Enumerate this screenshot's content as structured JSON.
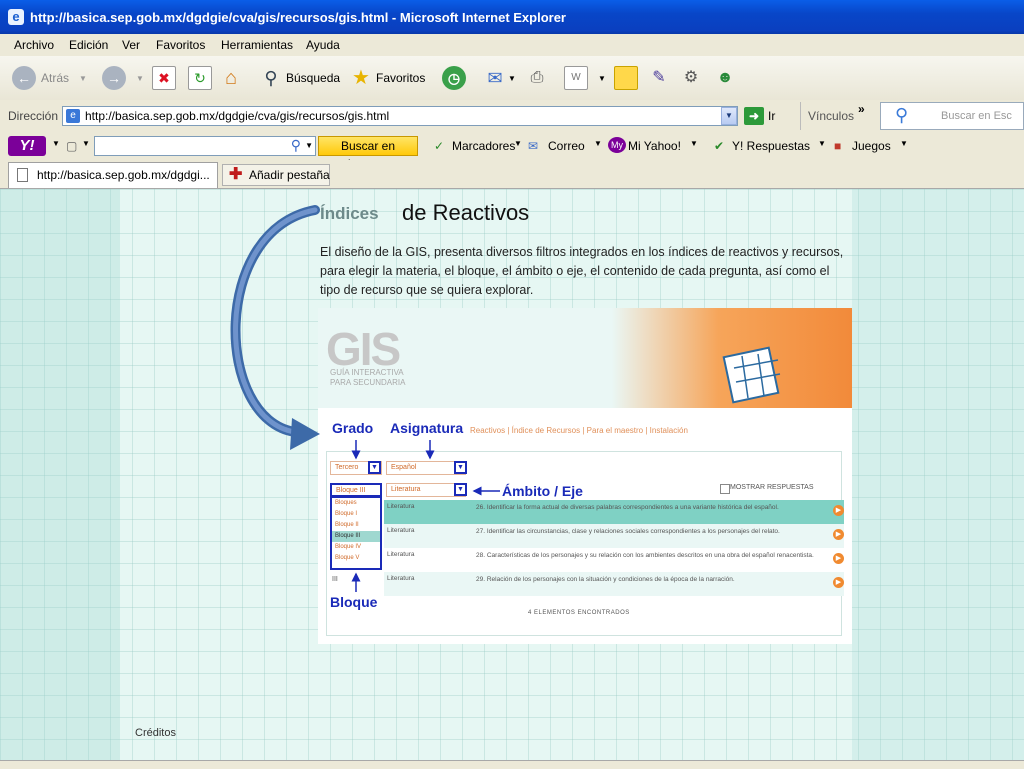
{
  "window": {
    "title": "http://basica.sep.gob.mx/dgdgie/cva/gis/recursos/gis.html - Microsoft Internet Explorer"
  },
  "menu": [
    "Archivo",
    "Edición",
    "Ver",
    "Favoritos",
    "Herramientas",
    "Ayuda"
  ],
  "toolbar": {
    "back": "Atrás",
    "search": "Búsqueda",
    "favorites": "Favoritos"
  },
  "address": {
    "label": "Dirección",
    "url": "http://basica.sep.gob.mx/dgdgie/cva/gis/recursos/gis.html",
    "go": "Ir",
    "links": "Vínculos",
    "search_placeholder": "Buscar en Esc"
  },
  "yahoo": {
    "search_button": "Buscar en Internet",
    "bookmarks": "Marcadores",
    "mail": "Correo",
    "my_yahoo": "Mi Yahoo!",
    "answers": "Y! Respuestas",
    "games": "Juegos"
  },
  "tabs": {
    "current": "http://basica.sep.gob.mx/dgdgi...",
    "add": "Añadir pestaña"
  },
  "page": {
    "heading_indices": "Índices",
    "heading_reactivos": "de Reactivos",
    "description": "El diseño de la GIS, presenta diversos filtros integrados en los índices de reactivos y recursos, para elegir la materia, el bloque, el ámbito o eje, el contenido de cada pregunta, así como el tipo de recurso que se quiera explorar.",
    "credits": "Créditos"
  },
  "gis": {
    "logo": "GIS",
    "subtitle": [
      "GUÍA INTERACTIVA",
      "PARA SECUNDARIA"
    ],
    "label_grado": "Grado",
    "label_asignatura": "Asignatura",
    "nav_rest": "Reactivos  |  Índice de Recursos  |  Para el maestro  |  Instalación",
    "grado_value": "Tercero",
    "asignatura_value": "Español",
    "bloque_value": "Bloque III",
    "ambito_value": "Literatura",
    "label_ambito": "Ámbito / Eje",
    "show_answers": "MOSTRAR RESPUESTAS",
    "bloque_options": [
      "Bloques",
      "Bloque I",
      "Bloque II",
      "Bloque III",
      "Bloque IV",
      "Bloque V"
    ],
    "label_bloque": "Bloque",
    "rows": [
      {
        "c1": "Literatura",
        "c2": "26. Identificar la forma actual de diversas palabras correspondientes a una variante histórica del español."
      },
      {
        "c1": "Literatura",
        "c2": "27. Identificar las circunstancias, clase y relaciones sociales correspondientes a los personajes del relato."
      },
      {
        "c1": "Literatura",
        "c2": "28. Características de los personajes y su relación con los ambientes descritos en una obra del español renacentista."
      },
      {
        "c1": "Literatura",
        "c2": "29. Relación de los personajes con la situación y condiciones de la época de la narración."
      }
    ],
    "row_prefix_last": "III",
    "found": "4 ELEMENTOS ENCONTRADOS"
  }
}
